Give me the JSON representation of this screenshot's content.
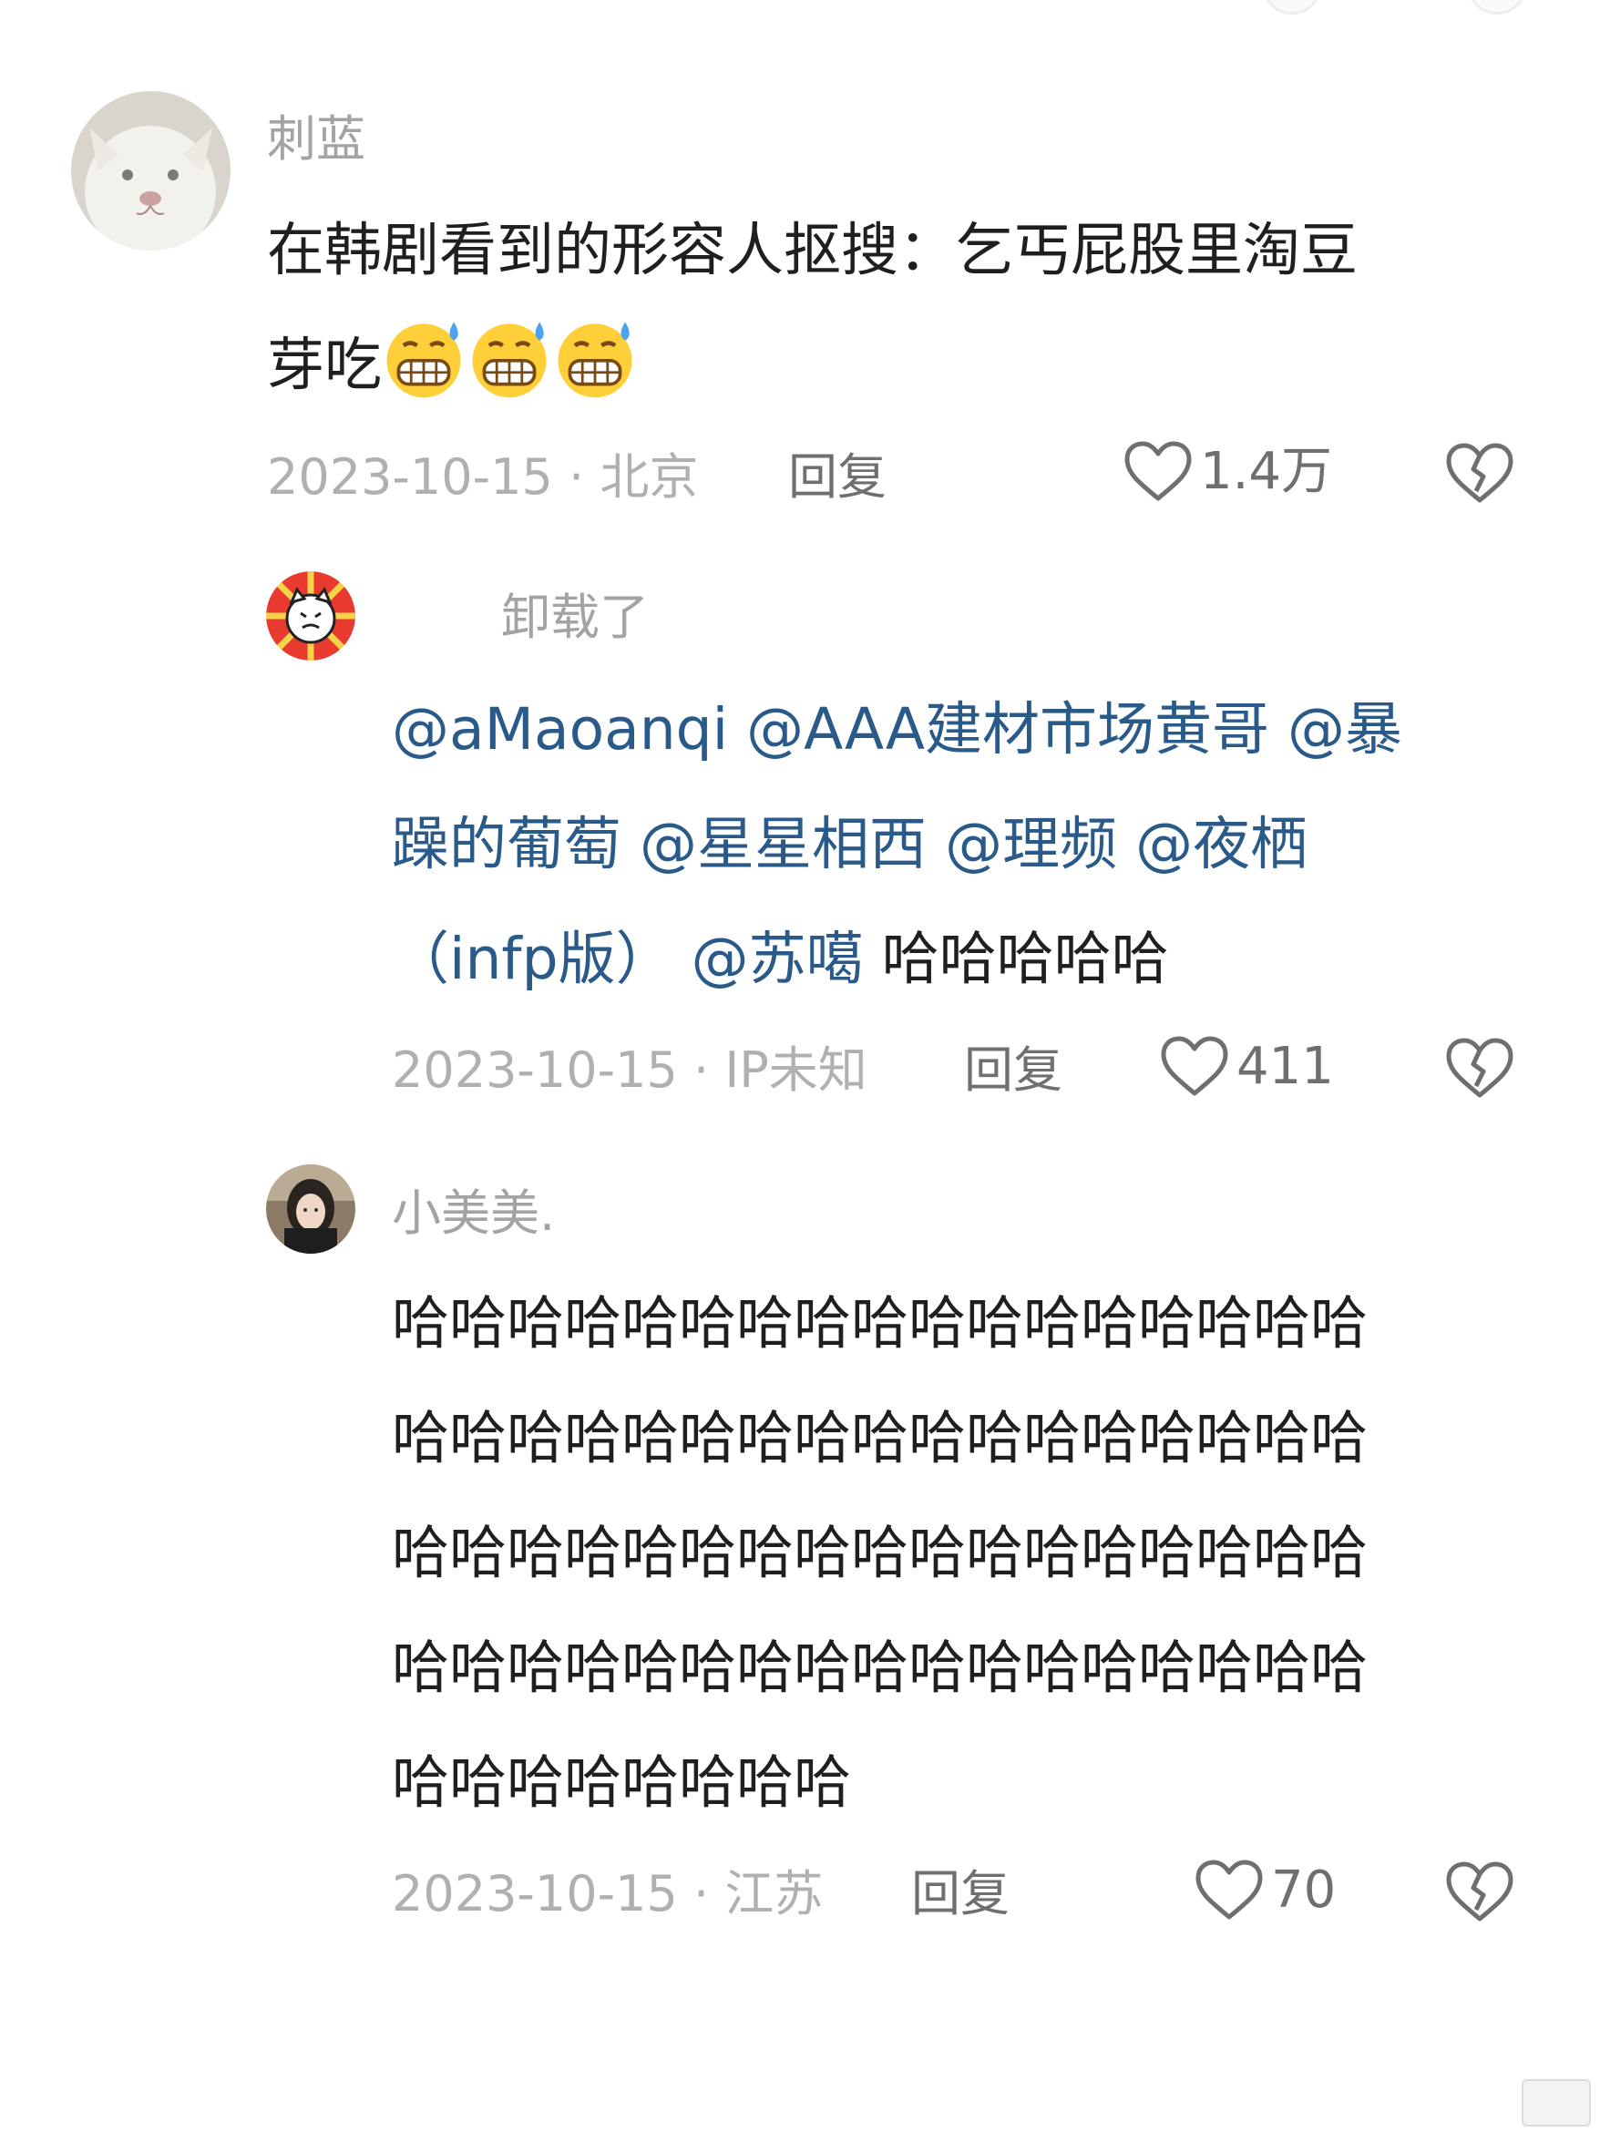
{
  "comments": [
    {
      "username": "刺蓝",
      "content_lines": [
        "在韩剧看到的形容人抠搜：乞丐屁股里淘豆",
        "芽吃"
      ],
      "emoji": "grimacing-sweat-emoji",
      "date": "2023-10-15 · 北京",
      "reply_label": "回复",
      "likes": "1.4万"
    },
    {
      "username": "卸载了",
      "line1": [
        "@aMaoanqi",
        "@AAA建材市场黄哥",
        "@暴"
      ],
      "line2": [
        "躁的葡萄",
        "@星星相西",
        "@理频",
        "@夜栖"
      ],
      "line3_mentions": [
        "（infp版）",
        "@苏噶"
      ],
      "line3_text": "哈哈哈哈哈",
      "date": "2023-10-15 · IP未知",
      "reply_label": "回复",
      "likes": "411"
    },
    {
      "username": "小美美.",
      "content_lines": [
        "哈哈哈哈哈哈哈哈哈哈哈哈哈哈哈哈哈",
        "哈哈哈哈哈哈哈哈哈哈哈哈哈哈哈哈哈",
        "哈哈哈哈哈哈哈哈哈哈哈哈哈哈哈哈哈",
        "哈哈哈哈哈哈哈哈哈哈哈哈哈哈哈哈哈",
        "哈哈哈哈哈哈哈哈"
      ],
      "date": "2023-10-15 · 江苏",
      "reply_label": "回复",
      "likes": "70"
    }
  ],
  "icons": {
    "like": "heart-outline-icon",
    "dislike": "broken-heart-icon"
  },
  "colors": {
    "mention": "#2a5a8a",
    "meta": "#b0b0b0",
    "username": "#a3a3a3",
    "action": "#6f6f6f"
  }
}
